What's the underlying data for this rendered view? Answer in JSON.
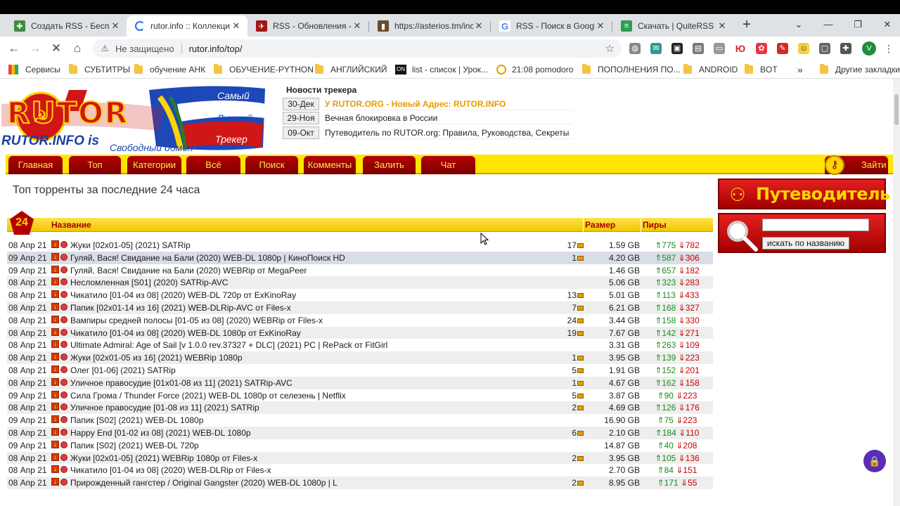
{
  "tabs": [
    {
      "title": "Создать RSS - Бесплат",
      "icon": "puzzle-icon",
      "color": "#3c8d3c",
      "active": false
    },
    {
      "title": "rutor.info :: Коллекци",
      "icon": "loading-spinner-icon",
      "color": "#1a73e8",
      "active": true
    },
    {
      "title": "RSS - Обновления - А",
      "icon": "rss-red-icon",
      "color": "#a31515",
      "active": false
    },
    {
      "title": "https://asterios.tm/inc",
      "icon": "asterios-icon",
      "color": "#6b4b2a",
      "active": false
    },
    {
      "title": "RSS - Поиск в Google",
      "icon": "google-icon",
      "color": "#4285f4",
      "active": false
    },
    {
      "title": "Скачать | QuiteRSS",
      "icon": "quiterss-icon",
      "color": "#2e9e4e",
      "active": false
    }
  ],
  "address": {
    "insecure_label": "Не защищено",
    "url": "rutor.info/top/"
  },
  "profile_initial": "V",
  "bookmarks": [
    {
      "label": "Сервисы",
      "icon": "apps-grid-icon"
    },
    {
      "label": "СУБТИТРЫ",
      "icon": "folder-icon"
    },
    {
      "label": "обучение АНК",
      "icon": "folder-icon"
    },
    {
      "label": "ОБУЧЕНИЕ-PYTHON",
      "icon": "folder-icon"
    },
    {
      "label": "АНГЛИЙСКИЙ",
      "icon": "folder-icon"
    },
    {
      "label": "list - список | Урок...",
      "icon": "on-icon"
    },
    {
      "label": "21:08 pomodoro",
      "icon": "pomodoro-icon"
    },
    {
      "label": "ПОПОЛНЕНИЯ ПО...",
      "icon": "folder-icon"
    },
    {
      "label": "ANDROID",
      "icon": "folder-icon"
    },
    {
      "label": "BOT",
      "icon": "folder-icon"
    },
    {
      "label": "Другие закладки",
      "icon": "folder-icon"
    }
  ],
  "logo": {
    "title": "RUTOR",
    "domain": "RUTOR.INFO is",
    "slogan_1": "Самый",
    "slogan_2": "Лучший",
    "slogan_3": "Трекер",
    "tagline": "Свободный обмен"
  },
  "news": {
    "title": "Новости трекера",
    "items": [
      {
        "date": "30-Дек",
        "text": "У RUTOR.ORG - Новый Адрес: RUTOR.INFO",
        "highlight": true
      },
      {
        "date": "29-Ноя",
        "text": "Вечная блокировка в России",
        "highlight": false
      },
      {
        "date": "09-Окт",
        "text": "Путеводитель по RUTOR.org: Правила, Руководства, Секреты",
        "highlight": false
      }
    ]
  },
  "menu": [
    "Главная",
    "Топ",
    "Категории",
    "Всё",
    "Поиск",
    "Комменты",
    "Залить",
    "Чат"
  ],
  "login_label": "Зайти",
  "heading": "Топ торренты за последние 24 часа",
  "badge": "24",
  "columns": {
    "name": "Название",
    "size": "Размер",
    "peers": "Пиры"
  },
  "rows": [
    {
      "date": "08 Апр 21",
      "name": "Жуки [02x01-05] (2021) SATRip",
      "comments": "17",
      "size": "1.59 GB",
      "seeds": "775",
      "leech": "782"
    },
    {
      "date": "09 Апр 21",
      "name": "Гуляй, Вася! Свидание на Бали (2020) WEB-DL 1080p | КиноПоиск HD",
      "comments": "1",
      "size": "4.20 GB",
      "seeds": "587",
      "leech": "306"
    },
    {
      "date": "09 Апр 21",
      "name": "Гуляй, Вася! Свидание на Бали (2020) WEBRip от MegaPeer",
      "comments": "",
      "size": "1.46 GB",
      "seeds": "657",
      "leech": "182"
    },
    {
      "date": "08 Апр 21",
      "name": "Несломленная [S01] (2020) SATRip-AVC",
      "comments": "",
      "size": "5.06 GB",
      "seeds": "323",
      "leech": "283"
    },
    {
      "date": "08 Апр 21",
      "name": "Чикатило [01-04 из 08] (2020) WEB-DL 720p от ExKinoRay",
      "comments": "13",
      "size": "5.01 GB",
      "seeds": "113",
      "leech": "433"
    },
    {
      "date": "08 Апр 21",
      "name": "Папик [02x01-14 из 16] (2021) WEB-DLRip-AVC от Files-x",
      "comments": "7",
      "size": "6.21 GB",
      "seeds": "168",
      "leech": "327"
    },
    {
      "date": "08 Апр 21",
      "name": "Вампиры средней полосы [01-05 из 08] (2020) WEBRip от Files-x",
      "comments": "24",
      "size": "3.44 GB",
      "seeds": "158",
      "leech": "330"
    },
    {
      "date": "08 Апр 21",
      "name": "Чикатило [01-04 из 08] (2020) WEB-DL 1080p от ExKinoRay",
      "comments": "19",
      "size": "7.67 GB",
      "seeds": "142",
      "leech": "271"
    },
    {
      "date": "08 Апр 21",
      "name": "Ultimate Admiral: Age of Sail [v 1.0.0 rev.37327 + DLC] (2021) PC | RePack от FitGirl",
      "comments": "",
      "size": "3.31 GB",
      "seeds": "263",
      "leech": "109"
    },
    {
      "date": "08 Апр 21",
      "name": "Жуки [02x01-05 из 16] (2021) WEBRip 1080p",
      "comments": "1",
      "size": "3.95 GB",
      "seeds": "139",
      "leech": "223"
    },
    {
      "date": "08 Апр 21",
      "name": "Олег [01-06] (2021) SATRip",
      "comments": "5",
      "size": "1.91 GB",
      "seeds": "152",
      "leech": "201"
    },
    {
      "date": "08 Апр 21",
      "name": "Уличное правосудие [01x01-08 из 11] (2021) SATRip-AVC",
      "comments": "1",
      "size": "4.67 GB",
      "seeds": "162",
      "leech": "158"
    },
    {
      "date": "09 Апр 21",
      "name": "Сила Грома / Thunder Force (2021) WEB-DL 1080p от селезень | Netflix",
      "comments": "5",
      "size": "3.87 GB",
      "seeds": "90",
      "leech": "223"
    },
    {
      "date": "08 Апр 21",
      "name": "Уличное правосудие [01-08 из 11] (2021) SATRip",
      "comments": "2",
      "size": "4.69 GB",
      "seeds": "126",
      "leech": "176"
    },
    {
      "date": "09 Апр 21",
      "name": "Папик [S02] (2021) WEB-DL 1080p",
      "comments": "",
      "size": "16.90 GB",
      "seeds": "75",
      "leech": "223"
    },
    {
      "date": "08 Апр 21",
      "name": "Happy End [01-02 из 08] (2021) WEB-DL 1080p",
      "comments": "6",
      "size": "2.10 GB",
      "seeds": "184",
      "leech": "110"
    },
    {
      "date": "09 Апр 21",
      "name": "Папик [S02] (2021) WEB-DL 720p",
      "comments": "",
      "size": "14.87 GB",
      "seeds": "40",
      "leech": "208"
    },
    {
      "date": "08 Апр 21",
      "name": "Жуки [02x01-05] (2021) WEBRip 1080p от Files-x",
      "comments": "2",
      "size": "3.95 GB",
      "seeds": "105",
      "leech": "136"
    },
    {
      "date": "08 Апр 21",
      "name": "Чикатило [01-04 из 08] (2020) WEB-DLRip от Files-x",
      "comments": "",
      "size": "2.70 GB",
      "seeds": "84",
      "leech": "151"
    },
    {
      "date": "08 Апр 21",
      "name": "Прирожденный гангстер / Original Gangster (2020) WEB-DL 1080p | L",
      "comments": "2",
      "size": "8.95 GB",
      "seeds": "171",
      "leech": "55"
    }
  ],
  "sidebar": {
    "guide": "Путеводитель",
    "search_button": "искать по названию",
    "search_value": ""
  }
}
